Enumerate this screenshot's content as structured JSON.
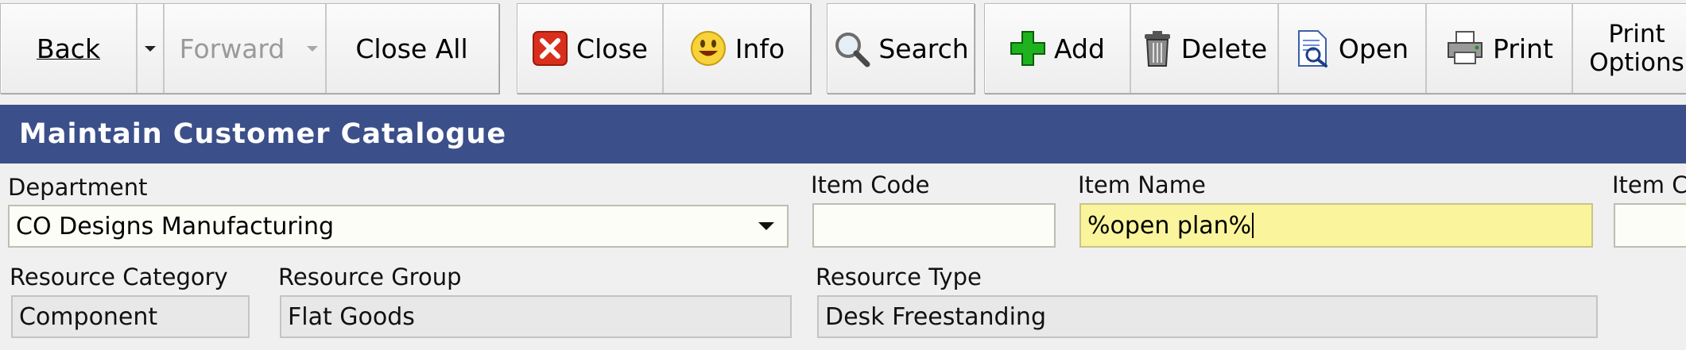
{
  "toolbar": {
    "back_label": "Back",
    "forward_label": "Forward",
    "close_all_label": "Close All",
    "close_label": "Close",
    "info_label": "Info",
    "search_label": "Search",
    "add_label": "Add",
    "delete_label": "Delete",
    "open_label": "Open",
    "print_label": "Print",
    "print_options_line1": "Print",
    "print_options_line2": "Options",
    "icons": {
      "close": "close-icon",
      "info": "smiley-icon",
      "search": "magnifier-icon",
      "add": "green-plus-icon",
      "delete": "trash-icon",
      "open": "open-document-icon",
      "print": "printer-icon"
    },
    "colors": {
      "close_red": "#d9301e",
      "info_yellow": "#f7d23a",
      "add_green": "#1fb21f"
    }
  },
  "page": {
    "title": "Maintain Customer Catalogue",
    "title_bg": "#3b4f8a"
  },
  "form": {
    "department": {
      "label": "Department",
      "value": "CO Designs Manufacturing"
    },
    "item_code": {
      "label": "Item Code",
      "value": ""
    },
    "item_name": {
      "label": "Item Name",
      "value": "%open plan%"
    },
    "item_class": {
      "label": "Item Cl",
      "value": ""
    },
    "resource_category": {
      "label": "Resource Category",
      "value": "Component"
    },
    "resource_group": {
      "label": "Resource Group",
      "value": "Flat Goods"
    },
    "resource_type": {
      "label": "Resource Type",
      "value": "Desk Freestanding"
    },
    "colors": {
      "highlight_field": "#faf59c",
      "input_bg": "#fdfdf7",
      "readonly_bg": "#e8e8e8"
    }
  }
}
